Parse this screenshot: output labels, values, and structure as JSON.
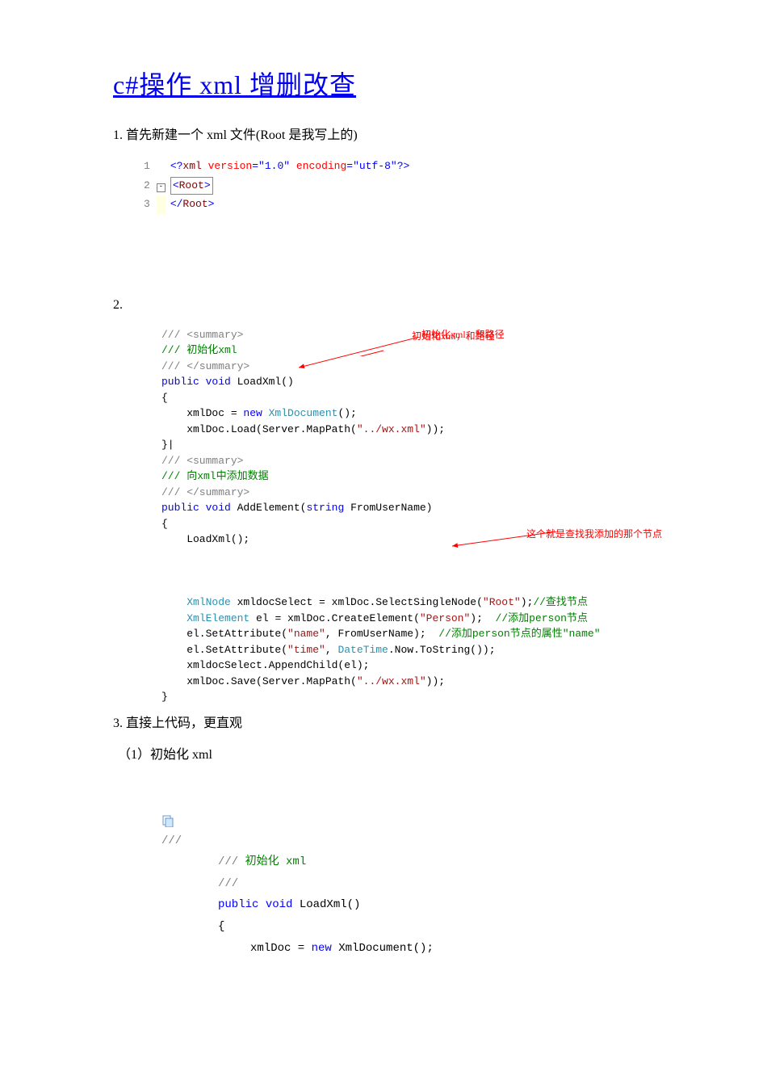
{
  "title": "c#操作 xml 增删改查",
  "step1": "1. 首先新建一个 xml 文件(Root 是我写上的)",
  "codeblock1": {
    "l1": {
      "ln": "1",
      "a": "<?",
      "b": "xml",
      "c": " version",
      "d": "=\"1.0\"",
      "e": " encoding",
      "f": "=\"utf-8\"",
      "g": "?>"
    },
    "l2": {
      "ln": "2",
      "open": "<",
      "tag": "Root",
      "close": ">"
    },
    "l3": {
      "ln": "3",
      "open": "</",
      "tag": "Root",
      "close": ">"
    }
  },
  "step2": "2.",
  "codeblock2": {
    "c1": "/// <summary>",
    "c2": "/// 初始化xml",
    "c3": "/// </summary>",
    "sig1a": "public",
    "sig1b": " void",
    "sig1c": " LoadXml()",
    "ob1": "{",
    "body1a": "    xmlDoc = ",
    "body1b": "new",
    "body1c": " XmlDocument",
    "body1d": "();",
    "body2a": "    xmlDoc.Load(Server.MapPath(",
    "body2b": "\"../wx.xml\"",
    "body2c": "));",
    "cb1": "}|",
    "c4": "/// <summary>",
    "c5": "/// 向xml中添加数据",
    "c6": "/// </summary>",
    "sig2a": "public",
    "sig2b": " void",
    "sig2c": " AddElement(",
    "sig2d": "string",
    "sig2e": " FromUserName)",
    "ob2": "{",
    "b3": "    LoadXml();",
    "b4a": "    ",
    "b4b": "XmlNode",
    "b4c": " xmldocSelect = xmlDoc.SelectSingleNode(",
    "b4d": "\"Root\"",
    "b4e": ");",
    "b4f": "//查找节点",
    "b5a": "    ",
    "b5b": "XmlElement",
    "b5c": " el = xmlDoc.CreateElement(",
    "b5d": "\"Person\"",
    "b5e": ");  ",
    "b5f": "//添加person节点",
    "b6a": "    el.SetAttribute(",
    "b6b": "\"name\"",
    "b6c": ", FromUserName);  ",
    "b6d": "//添加person节点的属性\"name\"",
    "b7a": "    el.SetAttribute(",
    "b7b": "\"time\"",
    "b7c": ", ",
    "b7d": "DateTime",
    "b7e": ".Now.ToString());",
    "b8": "    xmldocSelect.AppendChild(el);",
    "b9a": "    xmlDoc.Save(Server.MapPath(",
    "b9b": "\"../wx.xml\"",
    "b9c": "));",
    "cb2": "}",
    "anno1": "初始化xml，和路径",
    "anno2": "这个就是查找我添加的那个节点"
  },
  "step3": "3. 直接上代码，更直观",
  "sub1": "（1）初始化 xml",
  "codeblock3": {
    "l1": "///",
    "l2a": "/// ",
    "l2b": "初始化 xml",
    "l3": "///",
    "l4a": "public ",
    "l4b": "void ",
    "l4c": "LoadXml()",
    "l5": "{",
    "l6a": "xmlDoc = ",
    "l6b": "new ",
    "l6c": "XmlDocument();"
  }
}
